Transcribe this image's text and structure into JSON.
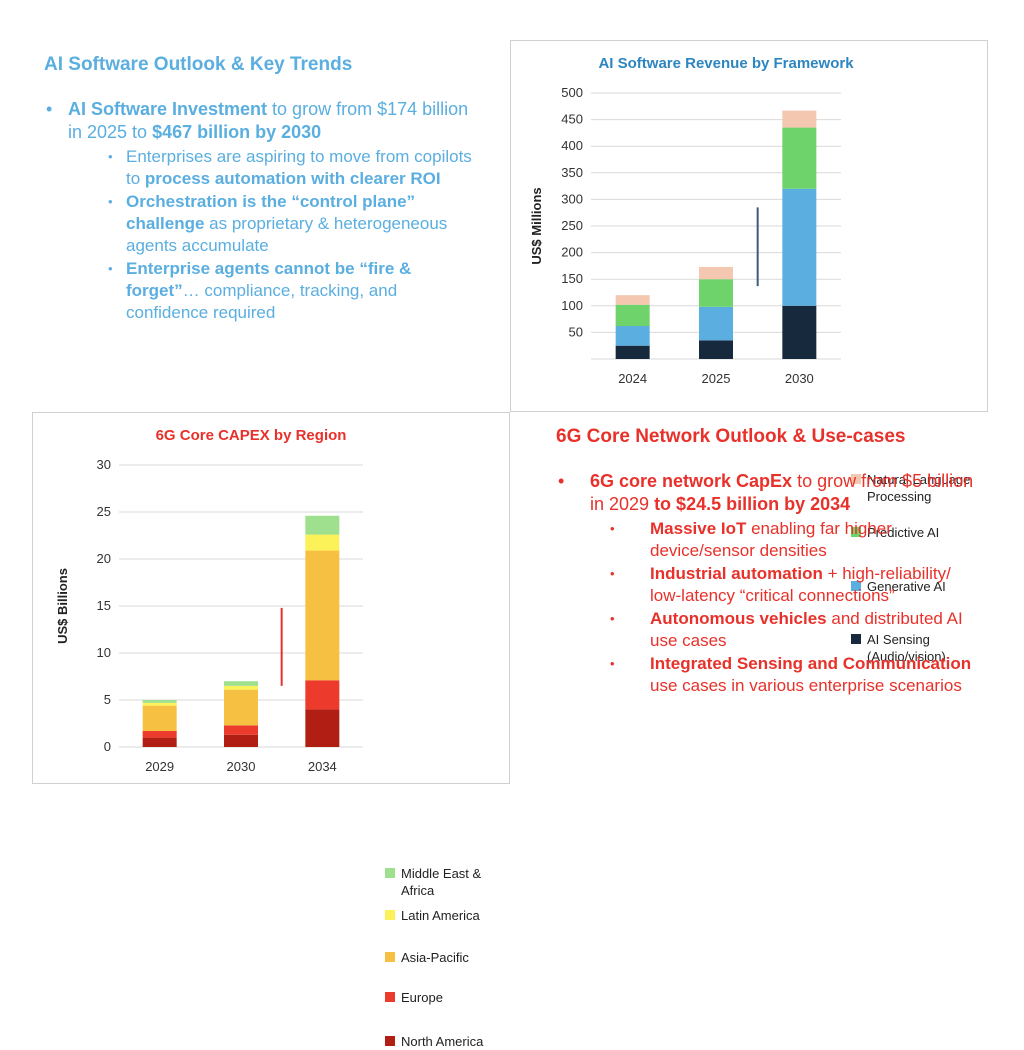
{
  "ai_outlook": {
    "title": "AI Software Outlook & Key Trends",
    "bullet": {
      "bold1": "AI Software Investment",
      "text1": " to grow from $174 billion in 2025 to ",
      "bold2": "$467 billion by 2030"
    },
    "sub": [
      {
        "pre": "Enterprises are aspiring to move from copilots to ",
        "bold": "process automation with clearer ROI",
        "post": ""
      },
      {
        "pre": "",
        "bold": "Orchestration is the “control plane” challenge",
        "post": " as proprietary & heterogeneous agents accumulate"
      },
      {
        "pre": "",
        "bold": "Enterprise agents cannot be “fire & forget”",
        "post": "… compliance, tracking, and confidence required"
      }
    ]
  },
  "sixg_outlook": {
    "title": "6G Core Network Outlook & Use-cases",
    "bullet": {
      "bold1": "6G core network CapEx",
      "text1": " to grow from $5 billion in 2029 ",
      "bold2": "to $24.5 billion by 2034"
    },
    "sub": [
      {
        "pre": "",
        "bold": "Massive IoT",
        "post": " enabling far higher device/sensor densities"
      },
      {
        "pre": "",
        "bold": "Industrial automation",
        "post": " + high-reliability/ low-latency “critical connections”"
      },
      {
        "pre": "",
        "bold": "Autonomous vehicles",
        "post": " and distributed AI use cases"
      },
      {
        "pre": "",
        "bold": "Integrated Sensing and Communication",
        "post": " use cases in various enterprise scenarios"
      }
    ]
  },
  "chart_data": [
    {
      "type": "bar",
      "stacked": true,
      "title": "AI Software Revenue by Framework",
      "ylabel": "US$ Millions",
      "title_color": "#2e86c1",
      "categories": [
        "2024",
        "2025",
        "2030"
      ],
      "ylim": [
        0,
        500
      ],
      "yticks": [
        50,
        100,
        150,
        200,
        250,
        300,
        350,
        400,
        450,
        500
      ],
      "grid": true,
      "legend": "right",
      "series": [
        {
          "name": "AI Sensing (Audio/vision)",
          "color": "#17293d",
          "values": [
            25,
            35,
            100
          ]
        },
        {
          "name": "Generative AI",
          "color": "#5aaee0",
          "values": [
            37,
            63,
            220
          ]
        },
        {
          "name": "Predictive AI",
          "color": "#6ed36a",
          "values": [
            40,
            52,
            115
          ]
        },
        {
          "name": "Natural Language Processing",
          "color": "#f3c7b0",
          "values": [
            18,
            23,
            32
          ]
        }
      ],
      "annotation": {
        "type": "vertical-line",
        "color": "#3a5a80",
        "between": [
          "2025",
          "2030"
        ],
        "y_range": [
          137,
          285
        ]
      }
    },
    {
      "type": "bar",
      "stacked": true,
      "title": "6G Core CAPEX by Region",
      "ylabel": "US$ Billions",
      "title_color": "#e8312a",
      "categories": [
        "2029",
        "2030",
        "2034"
      ],
      "ylim": [
        0,
        30
      ],
      "yticks": [
        0,
        5,
        10,
        15,
        20,
        25,
        30
      ],
      "grid": true,
      "legend": "right",
      "series": [
        {
          "name": "North America",
          "color": "#b01e14",
          "values": [
            1.0,
            1.3,
            4.0
          ]
        },
        {
          "name": "Europe",
          "color": "#ec3a2c",
          "values": [
            0.7,
            1.0,
            3.1
          ]
        },
        {
          "name": "Asia-Pacific",
          "color": "#f6c142",
          "values": [
            2.7,
            3.8,
            13.8
          ]
        },
        {
          "name": "Latin America",
          "color": "#fbf25a",
          "values": [
            0.3,
            0.4,
            1.7
          ]
        },
        {
          "name": "Middle East & Africa",
          "color": "#9fe08f",
          "values": [
            0.3,
            0.5,
            2.0
          ]
        }
      ],
      "annotation": {
        "type": "vertical-line",
        "color": "#e8312a",
        "between": [
          "2030",
          "2034"
        ],
        "y_range": [
          6.5,
          14.8
        ]
      }
    }
  ]
}
